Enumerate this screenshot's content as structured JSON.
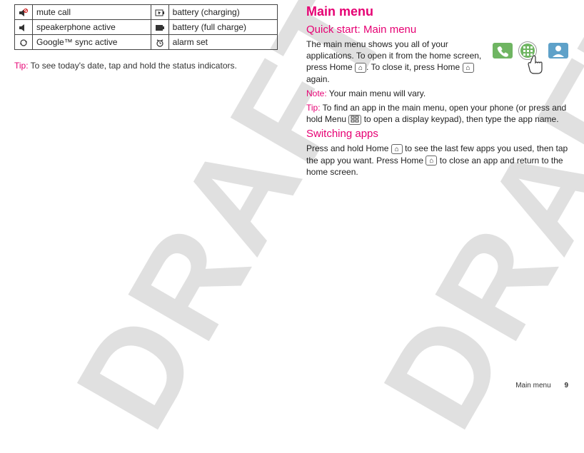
{
  "watermark": "DRAFT",
  "left": {
    "table": [
      {
        "icon": "mute-call-icon",
        "label": "mute call",
        "icon2": "battery-charging-icon",
        "label2": "battery (charging)"
      },
      {
        "icon": "speakerphone-icon",
        "label": "speakerphone active",
        "icon2": "battery-full-icon",
        "label2": "battery (full charge)"
      },
      {
        "icon": "sync-icon",
        "label": "Google™ sync active",
        "icon2": "alarm-icon",
        "label2": "alarm set"
      }
    ],
    "tip_label": "Tip:",
    "tip_text": " To see today's date, tap and hold the status indicators."
  },
  "right": {
    "h1": "Main menu",
    "quick_start": {
      "heading": "Quick start: Main menu",
      "p1a": "The main menu shows you all of your applications. To open it from the home screen, press Home ",
      "p1b": ". To close it, press Home ",
      "p1c": " again.",
      "note_label": "Note:",
      "note_text": " Your main menu will vary.",
      "tip_label": "Tip:",
      "tip_text_a": "  To find an app in the main menu, open your phone (or press and hold Menu ",
      "tip_text_b": " to open a display keypad), then type the app name."
    },
    "switching": {
      "heading": "Switching apps",
      "p_a": "Press and hold Home ",
      "p_b": " to see the last few apps you used, then tap the app you want. Press Home ",
      "p_c": " to close an app and return to the home screen."
    }
  },
  "keys": {
    "home": "⌂",
    "menu": "▭"
  },
  "footer": {
    "section": "Main menu",
    "page": "9"
  }
}
